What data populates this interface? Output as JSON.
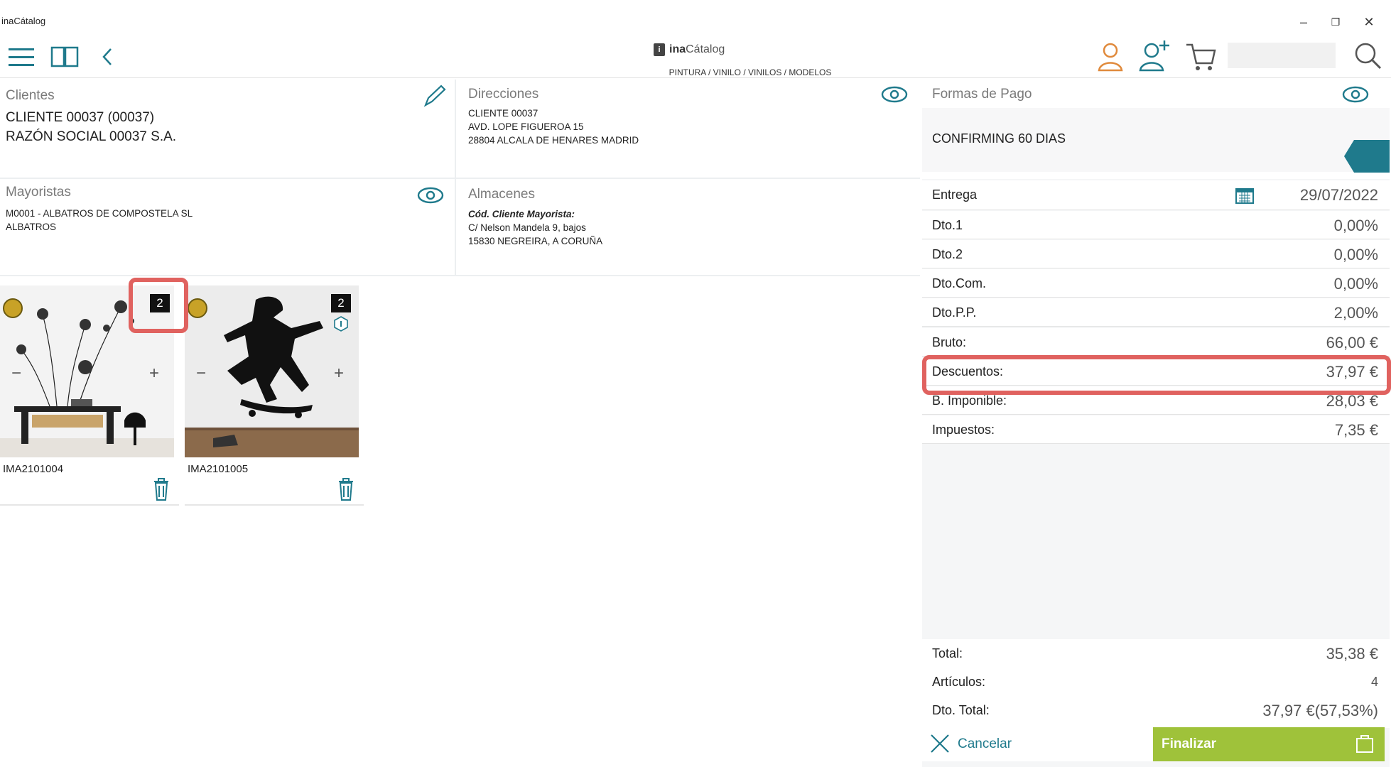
{
  "window": {
    "title": "inaCátalog",
    "minimize": "–",
    "restore": "❐",
    "close": "✕"
  },
  "header": {
    "logo_mark": "i",
    "logo_prefix": "ina",
    "logo_suffix": "Cátalog",
    "breadcrumb": "PINTURA / VINILO / VINILOS / MODELOS",
    "icons": [
      "menu-icon",
      "book-icon",
      "back-icon",
      "user-icon",
      "add-user-icon",
      "cart-icon",
      "search-icon"
    ]
  },
  "clientes": {
    "title": "Clientes",
    "line1": "CLIENTE 00037 (00037)",
    "line2": "RAZÓN SOCIAL  00037 S.A."
  },
  "direcciones": {
    "title": "Direcciones",
    "line1": "CLIENTE 00037",
    "line2": "AVD. LOPE FIGUEROA 15",
    "line3": "28804 ALCALA DE HENARES MADRID"
  },
  "formas_pago": {
    "title": "Formas de Pago",
    "value": "CONFIRMING 60 DIAS"
  },
  "mayoristas": {
    "title": "Mayoristas",
    "line1": "M0001 - ALBATROS DE COMPOSTELA SL",
    "line2": "ALBATROS"
  },
  "almacenes": {
    "title": "Almacenes",
    "line1": "Cód. Cliente Mayorista:",
    "line2": "C/ Nelson Mandela 9, bajos",
    "line3": "15830 NEGREIRA, A CORUÑA"
  },
  "products": [
    {
      "code": "IMA2101004",
      "qty": "2",
      "minus": "−",
      "plus": "+"
    },
    {
      "code": "IMA2101005",
      "qty": "2",
      "minus": "−",
      "plus": "+"
    }
  ],
  "summary": {
    "entrega_label": "Entrega",
    "entrega_value": "29/07/2022",
    "dto1_label": "Dto.1",
    "dto1_value": "0,00%",
    "dto2_label": "Dto.2",
    "dto2_value": "0,00%",
    "dtocom_label": "Dto.Com.",
    "dtocom_value": "0,00%",
    "dtopp_label": "Dto.P.P.",
    "dtopp_value": "2,00%",
    "bruto_label": "Bruto:",
    "bruto_value": "66,00 €",
    "descuentos_label": "Descuentos:",
    "descuentos_value": "37,97 €",
    "bimponible_label": "B. Imponible:",
    "bimponible_value": "28,03 €",
    "impuestos_label": "Impuestos:",
    "impuestos_value": "7,35 €"
  },
  "totals": {
    "total_label": "Total:",
    "total_value": "35,38 €",
    "articulos_label": "Artículos:",
    "articulos_value": "4",
    "dtototal_label": "Dto. Total:",
    "dtototal_value": "37,97 €(57,53%)"
  },
  "actions": {
    "cancel": "Cancelar",
    "finalize": "Finalizar"
  },
  "colors": {
    "accent": "#1f7a8c",
    "finalize_bg": "#9fc23a",
    "highlight": "#e0625f",
    "icon_orange": "#e08a3c"
  }
}
